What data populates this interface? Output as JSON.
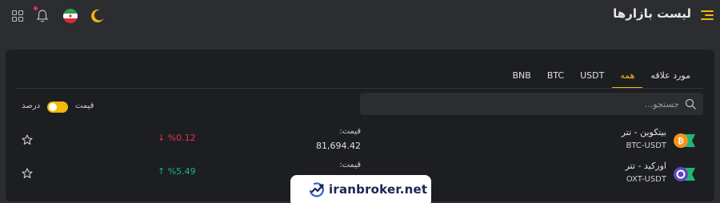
{
  "header": {
    "title": "لیست بازارها",
    "menu_icon": "hamburger-icon",
    "icons": [
      "theme-moon-icon",
      "language-flag-icon",
      "bell-icon",
      "apps-grid-icon"
    ],
    "accent": "#f0b90b"
  },
  "tabs": [
    {
      "label": "مورد علاقه",
      "active": false
    },
    {
      "label": "همه",
      "active": true
    },
    {
      "label": "USDT",
      "active": false
    },
    {
      "label": "BTC",
      "active": false
    },
    {
      "label": "BNB",
      "active": false
    }
  ],
  "search": {
    "placeholder": "جستجو..."
  },
  "display_toggle": {
    "price_label": "قیمت",
    "percent_label": "درصد",
    "selected": "price"
  },
  "markets": [
    {
      "name": "بیتکوین - تتر",
      "pair": "BTC-USDT",
      "price_label": "قیمت:",
      "price": "81,694.42",
      "change": "%0.12",
      "direction": "down",
      "direction_icon": "↓",
      "logo": "btc-logo-icon"
    },
    {
      "name": "اورکید - تتر",
      "pair": "OXT-USDT",
      "price_label": "قیمت:",
      "price": "",
      "change": "%5.49",
      "direction": "up",
      "direction_icon": "↑",
      "logo": "oxt-logo-icon"
    }
  ],
  "watermark": {
    "text": "iranbroker.net"
  },
  "colors": {
    "up": "#1db877",
    "down": "#e0344a",
    "panel": "#1d1e22",
    "background": "#2b2d31"
  }
}
